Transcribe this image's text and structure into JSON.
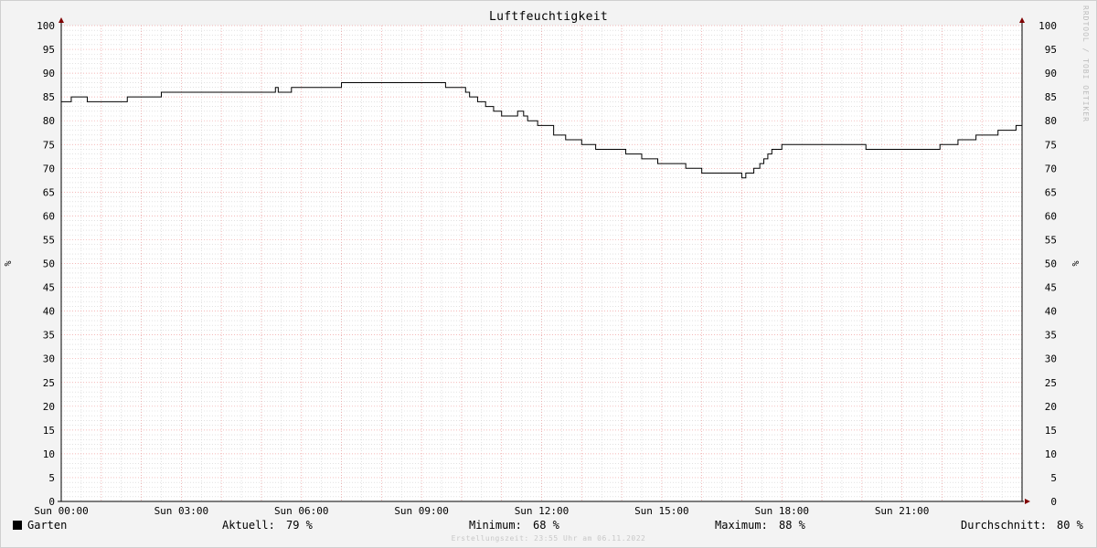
{
  "title": "Luftfeuchtigkeit",
  "watermark": "RRDTOOL / TOBI OETIKER",
  "stamp": "Erstellungszeit: 23:55 Uhr am 06.11.2022",
  "legend": {
    "series_name": "Garten",
    "current_label": "Aktuell:",
    "current_value": "79 %",
    "min_label": "Minimum:",
    "min_value": "68 %",
    "max_label": "Maximum:",
    "max_value": "88 %",
    "avg_label": "Durchschnitt:",
    "avg_value": "80 %"
  },
  "colors": {
    "line": "#000000",
    "major_grid": "#f0a0a0",
    "minor_grid": "#d0d0d0",
    "plot_bg": "#ffffff",
    "axis": "#800000"
  },
  "chart_data": {
    "type": "line",
    "title": "Luftfeuchtigkeit",
    "ylabel": "%",
    "ylabel_right": "%",
    "ylim": [
      0,
      100
    ],
    "yticks": [
      0,
      5,
      10,
      15,
      20,
      25,
      30,
      35,
      40,
      45,
      50,
      55,
      60,
      65,
      70,
      75,
      80,
      85,
      90,
      95,
      100
    ],
    "xlim": [
      0,
      24
    ],
    "xticks": [
      0,
      3,
      6,
      9,
      12,
      15,
      18,
      21
    ],
    "xtick_labels": [
      "Sun 00:00",
      "Sun 03:00",
      "Sun 06:00",
      "Sun 09:00",
      "Sun 12:00",
      "Sun 15:00",
      "Sun 18:00",
      "Sun 21:00"
    ],
    "grid": true,
    "series": [
      {
        "name": "Garten",
        "step": true,
        "x": [
          0.0,
          0.25,
          0.65,
          1.65,
          2.5,
          5.35,
          5.42,
          5.5,
          5.75,
          7.0,
          9.6,
          10.1,
          10.2,
          10.4,
          10.6,
          10.8,
          11.0,
          11.4,
          11.55,
          11.65,
          11.9,
          12.3,
          12.6,
          13.0,
          13.35,
          14.1,
          14.5,
          14.9,
          15.6,
          16.0,
          17.0,
          17.1,
          17.3,
          17.45,
          17.55,
          17.65,
          17.75,
          17.85,
          18.0,
          20.1,
          21.95,
          22.4,
          22.85,
          23.4,
          23.85
        ],
        "y": [
          84,
          85,
          84,
          85,
          86,
          87,
          86,
          86,
          87,
          88,
          87,
          86,
          85,
          84,
          83,
          82,
          81,
          82,
          81,
          80,
          79,
          77,
          76,
          75,
          74,
          73,
          72,
          71,
          70,
          69,
          68,
          69,
          70,
          71,
          72,
          73,
          74,
          74,
          75,
          74,
          75,
          76,
          77,
          78,
          79
        ]
      }
    ]
  }
}
